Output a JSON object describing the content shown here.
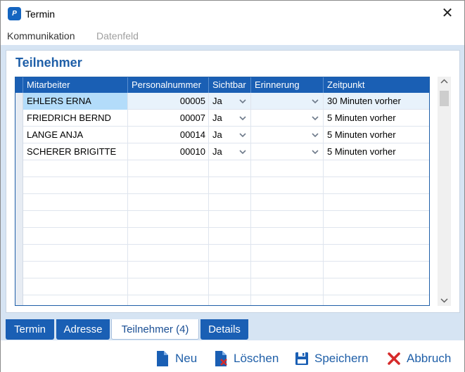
{
  "window": {
    "title": "Termin",
    "app_icon_text": "P"
  },
  "menu": {
    "items": [
      "Kommunikation",
      "Datenfeld"
    ]
  },
  "panel": {
    "title": "Teilnehmer"
  },
  "grid": {
    "columns": [
      "Mitarbeiter",
      "Personalnummer",
      "Sichtbar",
      "Erinnerung",
      "Zeitpunkt"
    ],
    "rows": [
      {
        "mitarbeiter": "EHLERS ERNA",
        "personalnummer": "00005",
        "sichtbar": "Ja",
        "erinnerung": "",
        "zeitpunkt": "30 Minuten vorher"
      },
      {
        "mitarbeiter": "FRIEDRICH BERND",
        "personalnummer": "00007",
        "sichtbar": "Ja",
        "erinnerung": "",
        "zeitpunkt": "5 Minuten vorher"
      },
      {
        "mitarbeiter": "LANGE ANJA",
        "personalnummer": "00014",
        "sichtbar": "Ja",
        "erinnerung": "",
        "zeitpunkt": "5 Minuten vorher"
      },
      {
        "mitarbeiter": "SCHERER BRIGITTE",
        "personalnummer": "00010",
        "sichtbar": "Ja",
        "erinnerung": "",
        "zeitpunkt": "5 Minuten vorher"
      }
    ],
    "selected_row": 0
  },
  "tabs": [
    {
      "label": "Termin",
      "active": false
    },
    {
      "label": "Adresse",
      "active": false
    },
    {
      "label": "Teilnehmer (4)",
      "active": true
    },
    {
      "label": "Details",
      "active": false
    }
  ],
  "footer": {
    "neu": "Neu",
    "loeschen": "Löschen",
    "speichern": "Speichern",
    "abbruch": "Abbruch"
  },
  "colors": {
    "accent": "#1a5fb4",
    "header_text": "#ffffff",
    "selection": "#b3dcfa",
    "delete_red": "#d62b2b"
  },
  "icons": {
    "close": "close-icon",
    "new": "new-document-icon",
    "delete": "delete-document-icon",
    "save": "save-icon",
    "cancel": "cancel-x-icon"
  }
}
